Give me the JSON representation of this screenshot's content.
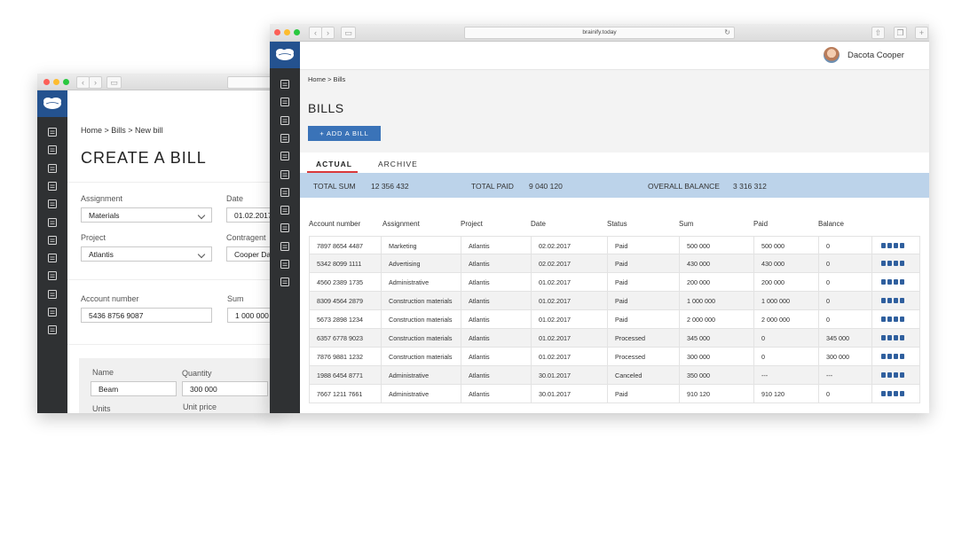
{
  "left_window": {
    "breadcrumb": "Home > Bills > New bill",
    "title": "CREATE A BILL",
    "assignment": {
      "label": "Assignment",
      "value": "Materials"
    },
    "date": {
      "label": "Date",
      "value": "01.02.2017"
    },
    "project": {
      "label": "Project",
      "value": "Atlantis"
    },
    "contragent": {
      "label": "Contragent",
      "value": "Cooper Da"
    },
    "account_number": {
      "label": "Account number",
      "value": "5436 8756 9087"
    },
    "sum": {
      "label": "Sum",
      "value": "1 000 000"
    },
    "item": {
      "name_label": "Name",
      "name_value": "Beam",
      "quantity_label": "Quantity",
      "quantity_value": "300 000",
      "units_label": "Units",
      "unit_price_label": "Unit price"
    }
  },
  "right_window": {
    "url": "brainify.today",
    "user_name": "Dacota Cooper",
    "breadcrumb": "Home > Bills",
    "title": "BILLS",
    "add_button": "+ ADD A BILL",
    "tabs": [
      {
        "label": "ACTUAL",
        "active": true
      },
      {
        "label": "ARCHIVE",
        "active": false
      }
    ],
    "summary": {
      "total_sum_label": "TOTAL SUM",
      "total_sum": "12 356 432",
      "total_paid_label": "TOTAL PAID",
      "total_paid": "9 040 120",
      "overall_balance_label": "OVERALL BALANCE",
      "overall_balance": "3 316 312"
    },
    "columns": [
      "Account number",
      "Assignment",
      "Project",
      "Date",
      "Status",
      "Sum",
      "Paid",
      "Balance"
    ],
    "rows": [
      [
        "7897 8654 4487",
        "Marketing",
        "Atlantis",
        "02.02.2017",
        "Paid",
        "500 000",
        "500 000",
        "0"
      ],
      [
        "5342 8099 1111",
        "Advertising",
        "Atlantis",
        "02.02.2017",
        "Paid",
        "430 000",
        "430 000",
        "0"
      ],
      [
        "4560 2389 1735",
        "Administrative",
        "Atlantis",
        "01.02.2017",
        "Paid",
        "200 000",
        "200 000",
        "0"
      ],
      [
        "8309 4564 2879",
        "Construction materials",
        "Atlantis",
        "01.02.2017",
        "Paid",
        "1 000 000",
        "1 000 000",
        "0"
      ],
      [
        "5673 2898 1234",
        "Construction materials",
        "Atlantis",
        "01.02.2017",
        "Paid",
        "2 000 000",
        "2 000 000",
        "0"
      ],
      [
        "6357 6778 9023",
        "Construction materials",
        "Atlantis",
        "01.02.2017",
        "Processed",
        "345 000",
        "0",
        "345 000"
      ],
      [
        "7876 9881 1232",
        "Construction materials",
        "Atlantis",
        "01.02.2017",
        "Processed",
        "300 000",
        "0",
        "300 000"
      ],
      [
        "1988 6454 8771",
        "Administrative",
        "Atlantis",
        "30.01.2017",
        "Canceled",
        "350 000",
        "---",
        "---"
      ],
      [
        "7667 1211 7661",
        "Administrative",
        "Atlantis",
        "30.01.2017",
        "Paid",
        "910 120",
        "910 120",
        "0"
      ]
    ],
    "row_action_icons": [
      "print-icon",
      "view-icon",
      "edit-icon",
      "delete-icon"
    ]
  },
  "colors": {
    "sidebar": "#2f3133",
    "logo_bg": "#24528f",
    "accent": "#3a73b8",
    "summary_bg": "#bcd3ea",
    "tab_underline": "#d9393b"
  }
}
